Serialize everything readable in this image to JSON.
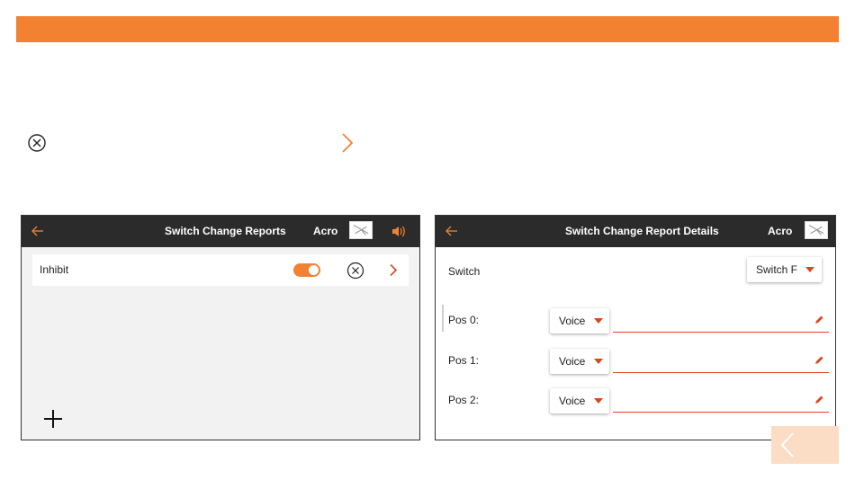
{
  "colors": {
    "accent": "#f28232",
    "header_bg": "#2b2b2b",
    "underline": "#d9471f"
  },
  "icons": {
    "legend": [
      "circle-x-icon",
      "chevron-right-icon"
    ],
    "header": [
      "back-arrow-icon",
      "model-plane-icon",
      "speaker-icon"
    ],
    "footer": [
      "plus-icon",
      "chevron-left-icon"
    ],
    "field": "pencil-icon"
  },
  "left_screen": {
    "title": "Switch Change Reports",
    "mode": "Acro",
    "row": {
      "label": "Inhibit",
      "toggle_on": true
    }
  },
  "right_screen": {
    "title": "Switch Change Report Details",
    "mode": "Acro",
    "switch_label": "Switch",
    "switch_value": "Switch F",
    "positions": [
      {
        "label": "Pos 0:",
        "type": "Voice",
        "text": ""
      },
      {
        "label": "Pos 1:",
        "type": "Voice",
        "text": ""
      },
      {
        "label": "Pos 2:",
        "type": "Voice",
        "text": ""
      }
    ]
  }
}
